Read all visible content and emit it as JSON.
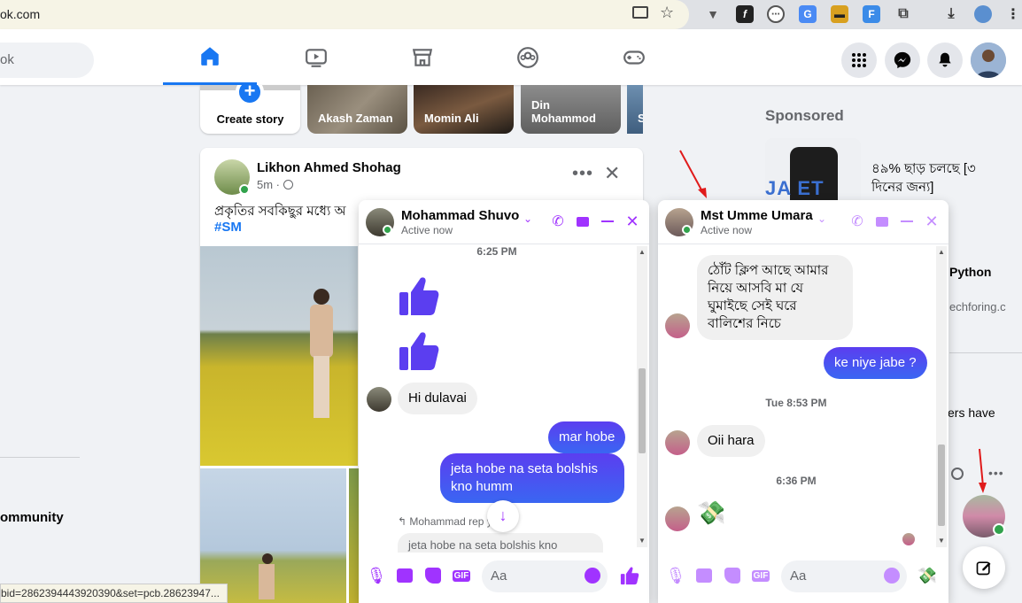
{
  "browser": {
    "url_partial": "ok.com",
    "status_url": "bid=2862394443920390&set=pcb.28623947..."
  },
  "header": {
    "search_placeholder": "ok"
  },
  "left": {
    "community_label": "ommunity"
  },
  "stories": [
    {
      "label": "Create story"
    },
    {
      "label": "Akash Zaman"
    },
    {
      "label": "Momin Ali"
    },
    {
      "label": "Din Mohammod"
    },
    {
      "label": "S"
    }
  ],
  "post": {
    "author": "Likhon Ahmed Shohag",
    "time": "5m ·",
    "text": "প্রকৃতির সবকিছুর মধ্যে অ",
    "hashtag": "#SM"
  },
  "right": {
    "sponsored": "Sponsored",
    "ad_text": "৪৯% ছাড় চলছে [৩ দিনের জন্য]",
    "python": "Python",
    "domain": "echforing.c",
    "others": "ers have"
  },
  "chat1": {
    "name": "Mohammad Shuvo",
    "status": "Active now",
    "time1": "6:25 PM",
    "msg_in": "Hi dulavai",
    "msg_out1": "mar hobe",
    "msg_out2": "jeta hobe na seta bolshis kno humm",
    "replied": "Mohammad rep   you",
    "reply_preview": "jeta hobe na seta bolshis kno humm",
    "placeholder": "Aa"
  },
  "chat2": {
    "name": "Mst Umme Umara",
    "status": "Active now",
    "msg_in1": "ঠোঁট ক্লিপ আছে আমার নিয়ে আসবি মা যে ঘুমাইছে সেই ঘরে বালিশের নিচে",
    "msg_out": "ke niye jabe ?",
    "time1": "Tue 8:53 PM",
    "msg_in2": "Oii hara",
    "time2": "6:36 PM",
    "placeholder": "Aa"
  },
  "colors": {
    "brand": "#1877f2",
    "messenger": "#a033ff",
    "green": "#31a24c"
  }
}
